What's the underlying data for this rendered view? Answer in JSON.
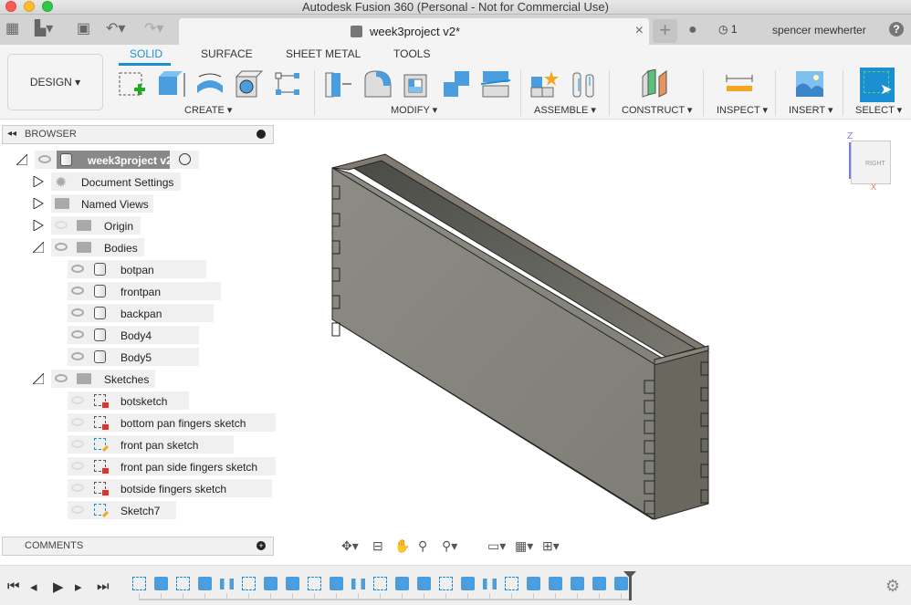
{
  "window": {
    "title": "Autodesk Fusion 360 (Personal - Not for Commercial Use)"
  },
  "appbar": {
    "document_tab": "week3project v2*",
    "jobs_count": "1",
    "user_name": "spencer mewherter",
    "help": "?"
  },
  "toolbar": {
    "workspace": "DESIGN ▾",
    "tabs": [
      "SOLID",
      "SURFACE",
      "SHEET METAL",
      "TOOLS"
    ],
    "active_tab": "SOLID",
    "groups": [
      {
        "label": "CREATE ▾",
        "tools": [
          "create-sketch",
          "extrude",
          "revolve",
          "hole",
          "pattern"
        ]
      },
      {
        "label": "MODIFY ▾",
        "tools": [
          "press-pull",
          "fillet",
          "shell",
          "combine",
          "split-body"
        ]
      },
      {
        "label": "ASSEMBLE ▾",
        "tools": [
          "new-component",
          "joint"
        ]
      },
      {
        "label": "CONSTRUCT ▾",
        "tools": [
          "offset-plane"
        ]
      },
      {
        "label": "INSPECT ▾",
        "tools": [
          "measure"
        ]
      },
      {
        "label": "INSERT ▾",
        "tools": [
          "insert-image"
        ]
      },
      {
        "label": "SELECT ▾",
        "tools": [
          "select"
        ]
      }
    ],
    "accent": "#1a8fd4"
  },
  "browser": {
    "title": "BROWSER",
    "root": "week3project v2",
    "items": [
      {
        "label": "Document Settings",
        "type": "settings"
      },
      {
        "label": "Named Views",
        "type": "folder"
      },
      {
        "label": "Origin",
        "type": "folder",
        "visible": false
      },
      {
        "label": "Bodies",
        "type": "folder",
        "expanded": true
      }
    ],
    "bodies": [
      "botpan",
      "frontpan",
      "backpan",
      "Body4",
      "Body5"
    ],
    "sketches_label": "Sketches",
    "sketches": [
      {
        "label": "botsketch",
        "state": "locked"
      },
      {
        "label": "bottom pan fingers sketch",
        "state": "locked"
      },
      {
        "label": "front pan sketch",
        "state": "editable"
      },
      {
        "label": "front pan side fingers sketch",
        "state": "locked"
      },
      {
        "label": "botside fingers sketch",
        "state": "locked"
      },
      {
        "label": "Sketch7",
        "state": "editable"
      }
    ]
  },
  "comments": {
    "title": "COMMENTS"
  },
  "viewcube": {
    "face": "RIGHT",
    "axes": [
      "Z",
      "X"
    ]
  },
  "timeline": {
    "steps": 23
  }
}
